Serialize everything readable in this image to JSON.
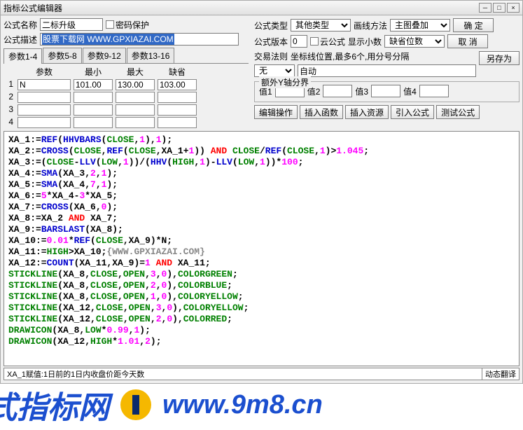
{
  "title": "指标公式编辑器",
  "labels": {
    "name": "公式名称",
    "pwd": "密码保护",
    "desc": "公式描述",
    "type": "公式类型",
    "drawmethod": "画线方法",
    "version": "公式版本",
    "cloud": "云公式",
    "decimals": "显示小数",
    "ok": "确  定",
    "cancel": "取  消",
    "saveas": "另存为",
    "tab1": "参数1-4",
    "tab2": "参数5-8",
    "tab3": "参数9-12",
    "tab4": "参数13-16",
    "ph_param": "参数",
    "ph_min": "最小",
    "ph_max": "最大",
    "ph_def": "缺省",
    "traderule": "交易法则",
    "coordhint": "坐标线位置,最多6个,用分号分隔",
    "auto": "自动",
    "none": "无",
    "extraY": "额外Y轴分界",
    "v1": "值1",
    "v2": "值2",
    "v3": "值3",
    "v4": "值4",
    "b_edit": "编辑操作",
    "b_func": "插入函数",
    "b_res": "插入资源",
    "b_import": "引入公式",
    "b_test": "测试公式"
  },
  "form": {
    "name": "二标升级",
    "desc": "股票下载网 WWW.GPXIAZAI.COM",
    "type_sel": "其他类型",
    "draw_sel": "主图叠加",
    "version": "0",
    "decimals_sel": "缺省位数"
  },
  "params": {
    "rows": [
      {
        "n": "1",
        "name": "N",
        "min": "",
        "max": "101.00",
        "maxv": "130.00",
        "def": "103.00"
      },
      {
        "n": "2",
        "name": "",
        "min": "",
        "max": "",
        "maxv": "",
        "def": ""
      },
      {
        "n": "3",
        "name": "",
        "min": "",
        "max": "",
        "maxv": "",
        "def": ""
      },
      {
        "n": "4",
        "name": "",
        "min": "",
        "max": "",
        "maxv": "",
        "def": ""
      }
    ]
  },
  "code": [
    [
      [
        "black",
        "XA_1:="
      ],
      [
        "blue",
        "REF"
      ],
      [
        "black",
        "("
      ],
      [
        "blue",
        "HHVBARS"
      ],
      [
        "black",
        "("
      ],
      [
        "green",
        "CLOSE"
      ],
      [
        "black",
        ","
      ],
      [
        "pink",
        "1"
      ],
      [
        "black",
        ")"
      ],
      [
        "black",
        ","
      ],
      [
        "pink",
        "1"
      ],
      [
        "black",
        ");"
      ]
    ],
    [
      [
        "black",
        "XA_2:="
      ],
      [
        "blue",
        "CROSS"
      ],
      [
        "black",
        "("
      ],
      [
        "green",
        "CLOSE"
      ],
      [
        "black",
        ","
      ],
      [
        "blue",
        "REF"
      ],
      [
        "black",
        "("
      ],
      [
        "green",
        "CLOSE"
      ],
      [
        "black",
        ",XA_1+"
      ],
      [
        "pink",
        "1"
      ],
      [
        "black",
        ")) "
      ],
      [
        "red",
        "AND"
      ],
      [
        "black",
        " "
      ],
      [
        "green",
        "CLOSE"
      ],
      [
        "black",
        "/"
      ],
      [
        "blue",
        "REF"
      ],
      [
        "black",
        "("
      ],
      [
        "green",
        "CLOSE"
      ],
      [
        "black",
        ","
      ],
      [
        "pink",
        "1"
      ],
      [
        "black",
        ")>"
      ],
      [
        "pink",
        "1.045"
      ],
      [
        "black",
        ";"
      ]
    ],
    [
      [
        "black",
        "XA_3:=("
      ],
      [
        "green",
        "CLOSE"
      ],
      [
        "black",
        "-"
      ],
      [
        "blue",
        "LLV"
      ],
      [
        "black",
        "("
      ],
      [
        "green",
        "LOW"
      ],
      [
        "black",
        ","
      ],
      [
        "pink",
        "1"
      ],
      [
        "black",
        "))/("
      ],
      [
        "blue",
        "HHV"
      ],
      [
        "black",
        "("
      ],
      [
        "green",
        "HIGH"
      ],
      [
        "black",
        ","
      ],
      [
        "pink",
        "1"
      ],
      [
        "black",
        ")-"
      ],
      [
        "blue",
        "LLV"
      ],
      [
        "black",
        "("
      ],
      [
        "green",
        "LOW"
      ],
      [
        "black",
        ","
      ],
      [
        "pink",
        "1"
      ],
      [
        "black",
        "))*"
      ],
      [
        "pink",
        "100"
      ],
      [
        "black",
        ";"
      ]
    ],
    [
      [
        "black",
        "XA_4:="
      ],
      [
        "blue",
        "SMA"
      ],
      [
        "black",
        "(XA_3,"
      ],
      [
        "pink",
        "2"
      ],
      [
        "black",
        ","
      ],
      [
        "pink",
        "1"
      ],
      [
        "black",
        ");"
      ]
    ],
    [
      [
        "black",
        "XA_5:="
      ],
      [
        "blue",
        "SMA"
      ],
      [
        "black",
        "(XA_4,"
      ],
      [
        "pink",
        "7"
      ],
      [
        "black",
        ","
      ],
      [
        "pink",
        "1"
      ],
      [
        "black",
        ");"
      ]
    ],
    [
      [
        "black",
        "XA_6:="
      ],
      [
        "pink",
        "5"
      ],
      [
        "black",
        "*XA_4-"
      ],
      [
        "pink",
        "3"
      ],
      [
        "black",
        "*XA_5;"
      ]
    ],
    [
      [
        "black",
        "XA_7:="
      ],
      [
        "blue",
        "CROSS"
      ],
      [
        "black",
        "(XA_6,"
      ],
      [
        "pink",
        "0"
      ],
      [
        "black",
        ");"
      ]
    ],
    [
      [
        "black",
        "XA_8:=XA_2 "
      ],
      [
        "red",
        "AND"
      ],
      [
        "black",
        " XA_7;"
      ]
    ],
    [
      [
        "black",
        "XA_9:="
      ],
      [
        "blue",
        "BARSLAST"
      ],
      [
        "black",
        "(XA_8);"
      ]
    ],
    [
      [
        "black",
        "XA_10:="
      ],
      [
        "pink",
        "0.01"
      ],
      [
        "black",
        "*"
      ],
      [
        "blue",
        "REF"
      ],
      [
        "black",
        "("
      ],
      [
        "green",
        "CLOSE"
      ],
      [
        "black",
        ",XA_9)*N;"
      ]
    ],
    [
      [
        "black",
        "XA_11:="
      ],
      [
        "green",
        "HIGH"
      ],
      [
        "black",
        ">XA_10;"
      ],
      [
        "gray",
        "{WWW.GPXIAZAI.COM}"
      ]
    ],
    [
      [
        "black",
        "XA_12:="
      ],
      [
        "blue",
        "COUNT"
      ],
      [
        "black",
        "(XA_11,XA_9)="
      ],
      [
        "pink",
        "1"
      ],
      [
        "black",
        " "
      ],
      [
        "red",
        "AND"
      ],
      [
        "black",
        " XA_11;"
      ]
    ],
    [
      [
        "green",
        "STICKLINE"
      ],
      [
        "black",
        "(XA_8,"
      ],
      [
        "green",
        "CLOSE"
      ],
      [
        "black",
        ","
      ],
      [
        "green",
        "OPEN"
      ],
      [
        "black",
        ","
      ],
      [
        "pink",
        "3"
      ],
      [
        "black",
        ","
      ],
      [
        "pink",
        "0"
      ],
      [
        "black",
        "),"
      ],
      [
        "green",
        "COLORGREEN"
      ],
      [
        "black",
        ";"
      ]
    ],
    [
      [
        "green",
        "STICKLINE"
      ],
      [
        "black",
        "(XA_8,"
      ],
      [
        "green",
        "CLOSE"
      ],
      [
        "black",
        ","
      ],
      [
        "green",
        "OPEN"
      ],
      [
        "black",
        ","
      ],
      [
        "pink",
        "2"
      ],
      [
        "black",
        ","
      ],
      [
        "pink",
        "0"
      ],
      [
        "black",
        "),"
      ],
      [
        "green",
        "COLORBLUE"
      ],
      [
        "black",
        ";"
      ]
    ],
    [
      [
        "green",
        "STICKLINE"
      ],
      [
        "black",
        "(XA_8,"
      ],
      [
        "green",
        "CLOSE"
      ],
      [
        "black",
        ","
      ],
      [
        "green",
        "OPEN"
      ],
      [
        "black",
        ","
      ],
      [
        "pink",
        "1"
      ],
      [
        "black",
        ","
      ],
      [
        "pink",
        "0"
      ],
      [
        "black",
        "),"
      ],
      [
        "green",
        "COLORYELLOW"
      ],
      [
        "black",
        ";"
      ]
    ],
    [
      [
        "green",
        "STICKLINE"
      ],
      [
        "black",
        "(XA_12,"
      ],
      [
        "green",
        "CLOSE"
      ],
      [
        "black",
        ","
      ],
      [
        "green",
        "OPEN"
      ],
      [
        "black",
        ","
      ],
      [
        "pink",
        "3"
      ],
      [
        "black",
        ","
      ],
      [
        "pink",
        "0"
      ],
      [
        "black",
        "),"
      ],
      [
        "green",
        "COLORYELLOW"
      ],
      [
        "black",
        ";"
      ]
    ],
    [
      [
        "green",
        "STICKLINE"
      ],
      [
        "black",
        "(XA_12,"
      ],
      [
        "green",
        "CLOSE"
      ],
      [
        "black",
        ","
      ],
      [
        "green",
        "OPEN"
      ],
      [
        "black",
        ","
      ],
      [
        "pink",
        "2"
      ],
      [
        "black",
        ","
      ],
      [
        "pink",
        "0"
      ],
      [
        "black",
        "),"
      ],
      [
        "green",
        "COLORRED"
      ],
      [
        "black",
        ";"
      ]
    ],
    [
      [
        "green",
        "DRAWICON"
      ],
      [
        "black",
        "(XA_8,"
      ],
      [
        "green",
        "LOW"
      ],
      [
        "black",
        "*"
      ],
      [
        "pink",
        "0.99"
      ],
      [
        "black",
        ","
      ],
      [
        "pink",
        "1"
      ],
      [
        "black",
        ");"
      ]
    ],
    [
      [
        "green",
        "DRAWICON"
      ],
      [
        "black",
        "(XA_12,"
      ],
      [
        "green",
        "HIGH"
      ],
      [
        "black",
        "*"
      ],
      [
        "pink",
        "1.01"
      ],
      [
        "black",
        ","
      ],
      [
        "pink",
        "2"
      ],
      [
        "black",
        ");"
      ]
    ]
  ],
  "status": {
    "left": "XA_1赋值:1日前的1日内收盘价距今天数",
    "right": "动态翻译"
  },
  "banner": {
    "t1": "式指标网",
    "t2": "www.9m8.cn"
  }
}
